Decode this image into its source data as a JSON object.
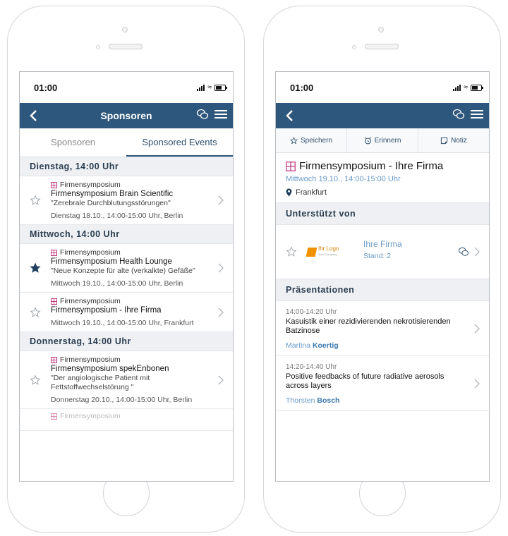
{
  "left": {
    "status": {
      "time": "01:00"
    },
    "nav": {
      "title": "Sponsoren"
    },
    "tabs": [
      {
        "label": "Sponsoren"
      },
      {
        "label": "Sponsored Events"
      }
    ],
    "sections": [
      {
        "header": "Dienstag, 14:00 Uhr"
      },
      {
        "header": "Mittwoch, 14:00 Uhr"
      },
      {
        "header": "Donnerstag, 14:00 Uhr"
      }
    ],
    "events": [
      {
        "type": "Firmensymposium",
        "title": "Firmensymposium Brain Scientific",
        "subtitle": "\"Zerebrale Durchblutungsstörungen\"",
        "meta": "Dienstag 18.10., 14:00-15:00 Uhr, Berlin",
        "starred": false
      },
      {
        "type": "Firmensymposium",
        "title": "Firmensymposium Health Lounge",
        "subtitle": "\"Neue Konzepte für alte (verkalkte) Gefäße\"",
        "meta": "Mittwoch 19.10., 14:00-15:00 Uhr, Berlin",
        "starred": true
      },
      {
        "type": "Firmensymposium",
        "title": "Firmensymposium - Ihre Firma",
        "subtitle": "",
        "meta": "Mittwoch 19.10., 14:00-15:00 Uhr, Frankfurt",
        "starred": false
      },
      {
        "type": "Firmensymposium",
        "title": "Firmensymposium spekEnbonen",
        "subtitle": "\"Der angiologische Patient mit Fettstoffwechselstörung \"",
        "meta": "Donnerstag 20.10., 14:00-15:00 Uhr, Berlin",
        "starred": false
      }
    ],
    "cutoff_type": "Firmensymposium"
  },
  "right": {
    "status": {
      "time": "01:00"
    },
    "actions": [
      {
        "label": "Speichern"
      },
      {
        "label": "Erinnern"
      },
      {
        "label": "Notiz"
      }
    ],
    "detail": {
      "title": "Firmensymposium - Ihre Firma",
      "time": "Mittwoch 19.10., 14:00-15:00 Uhr",
      "location": "Frankfurt"
    },
    "supported_header": "Unterstützt von",
    "sponsor": {
      "logo_text": "Ihr Logo",
      "logo_sub": "Your Company",
      "name": "Ihre Firma",
      "stand": "Stand: 2"
    },
    "presentations_header": "Präsentationen",
    "presentations": [
      {
        "time": "14:00-14:20 Uhr",
        "title": "Kasuistik einer rezidivierenden nekrotisierenden Batzinose",
        "speaker_first": "Martina",
        "speaker_last": "Koertig"
      },
      {
        "time": "14:20-14:40 Uhr",
        "title": "Positive feedbacks of future radiative aerosols across layers",
        "speaker_first": "Thorsten",
        "speaker_last": "Bosch"
      }
    ]
  },
  "colors": {
    "nav": "#2d577c",
    "accent_link": "#6a9bc9",
    "symposium_icon": "#c0397f",
    "section_bg": "#eef0f3"
  },
  "icons": [
    "back-chevron-icon",
    "chat-icon",
    "hamburger-menu-icon",
    "star-icon",
    "star-filled-icon",
    "chevron-right-icon",
    "grid-icon",
    "map-pin-icon",
    "alarm-clock-icon",
    "note-icon"
  ]
}
